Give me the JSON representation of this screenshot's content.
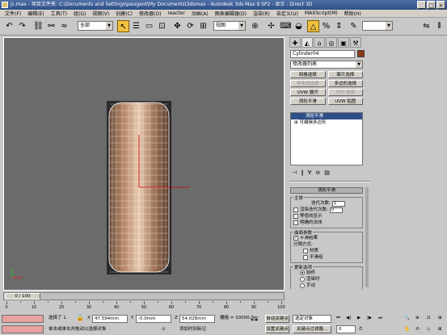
{
  "window": {
    "title": "jc.max - 项目文件夹: C:\\Documents and Settings\\peugeot\\My Documents\\3dsmax - Autodesk 3ds Max 9 SP2 - 显示 : Direct 3D",
    "min": "_",
    "max": "□",
    "close": "×"
  },
  "menu": [
    "文件(F)",
    "编辑(E)",
    "工具(T)",
    "组(G)",
    "视图(V)",
    "创建(C)",
    "修改器(O)",
    "reactor",
    "动画(A)",
    "图表编辑器(D)",
    "渲染(R)",
    "自定义(U)",
    "MAXScript(M)",
    "帮助(H)"
  ],
  "toolbar": {
    "selection_filter": "全部",
    "ref_coord": "视图",
    "named_sel": ""
  },
  "viewport": {
    "label": "",
    "background": "#6b6b6b",
    "object_color": "#c09070",
    "wire_color": "#ffffff"
  },
  "panel": {
    "tabs": [
      "create-icon",
      "modify-icon",
      "hierarchy-icon",
      "motion-icon",
      "display-icon",
      "utilities-icon"
    ],
    "object_name": "Cylinder04",
    "object_color": "#8b3a12",
    "modifier_list": "修改器列表",
    "modifier_buttons": [
      {
        "label": "网格选择",
        "disabled": false
      },
      {
        "label": "面片选择",
        "disabled": false
      },
      {
        "label": "样条线选择",
        "disabled": true
      },
      {
        "label": "多边形选择",
        "disabled": false
      },
      {
        "label": "UVW 展开",
        "disabled": false
      },
      {
        "label": "FFD 选择",
        "disabled": true
      },
      {
        "label": "涡轮平滑",
        "disabled": false
      },
      {
        "label": "UVW 贴图",
        "disabled": false
      }
    ],
    "stack": [
      "涡轮平滑",
      "可编辑多边形"
    ],
    "rollout": {
      "title": "涡轮平滑",
      "main_group": "主体",
      "iterations_label": "迭代次数:",
      "iterations_value": "1",
      "render_iters_label": "渲染迭代次数:",
      "render_iters_value": "0",
      "isoline_display": "等值线显示",
      "explicit_normals": "明确的法线",
      "surface_group": "曲面参数",
      "smooth_result": "平滑结果",
      "separate_label": "分隔方式:",
      "materials": "材质",
      "smoothing_groups": "平滑组",
      "update_group": "更新选项",
      "always": "始终",
      "when_rendering": "渲染时",
      "manually": "手动"
    }
  },
  "timeline": {
    "slider_label": "0 / 100",
    "ticks": [
      "0",
      "10",
      "20",
      "30",
      "40",
      "50",
      "60",
      "70",
      "80",
      "90",
      "100"
    ]
  },
  "status": {
    "selected": "选择了 1",
    "x": "47.594mm",
    "y": "-0.0mm",
    "z": "54.028mm",
    "grid": "栅格 = 10000.0m",
    "auto_key": "自动关键点",
    "selected_obj": "选定对象",
    "set_key": "设置关键点",
    "key_filters": "关键点过滤器...",
    "prompt": "单击或单击并拖动以选择对象",
    "add_time_tag": "添加时间标记",
    "frame": "0"
  }
}
